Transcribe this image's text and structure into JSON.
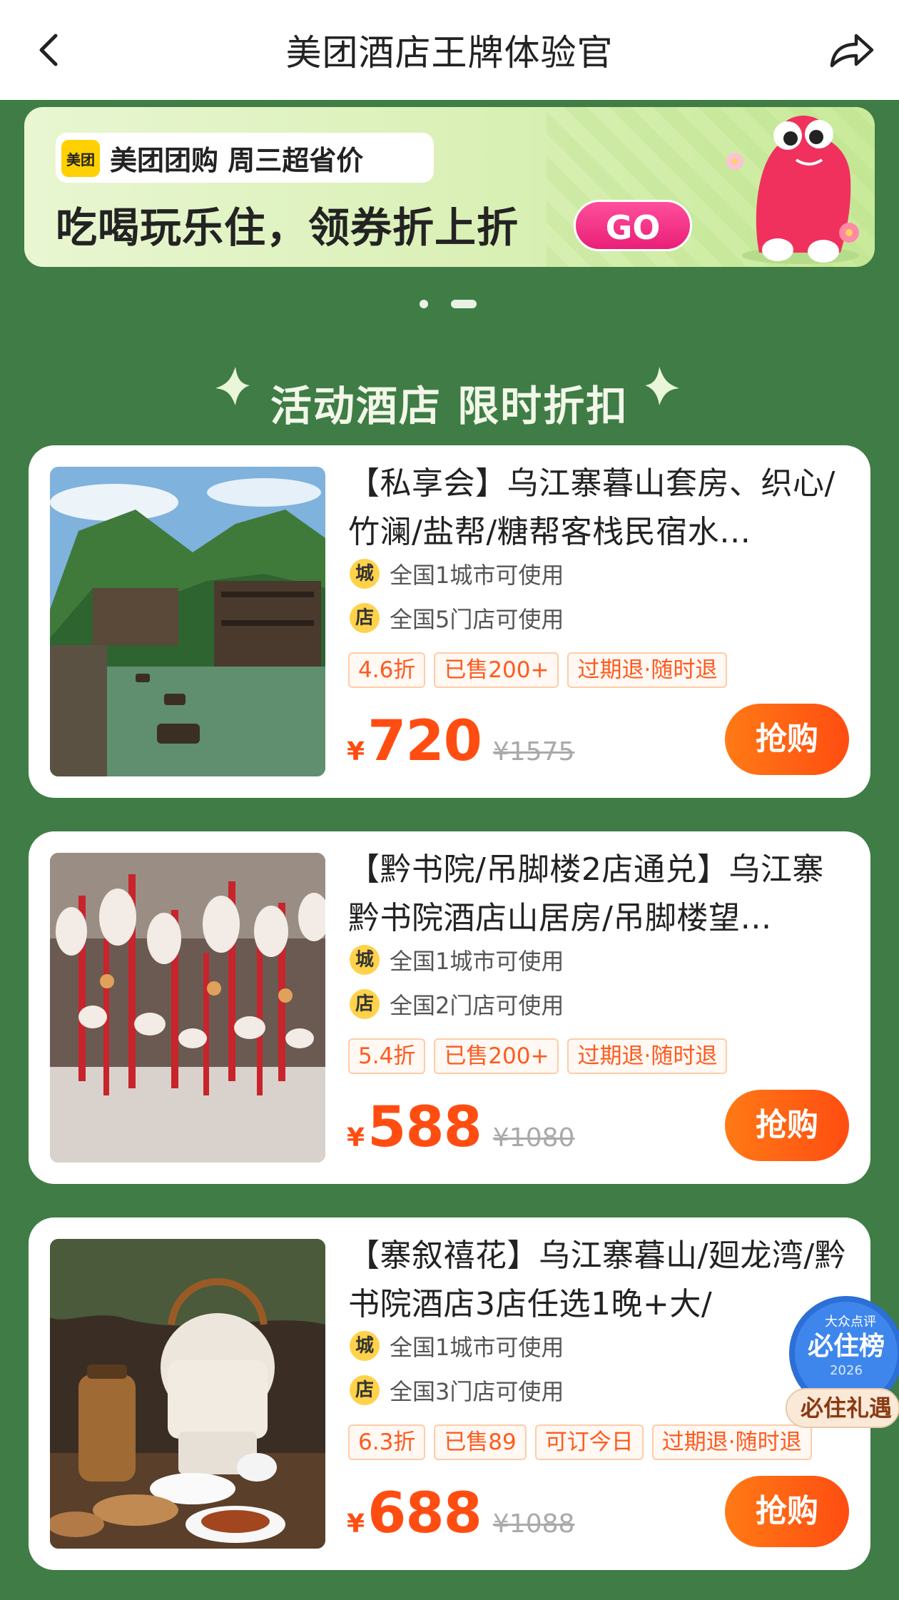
{
  "header": {
    "title": "美团酒店王牌体验官",
    "back_icon": "chevron-left-icon",
    "share_icon": "share-icon"
  },
  "banner": {
    "logo_text": "美团",
    "brand_text": "美团团购 周三超省价",
    "headline": "吃喝玩乐住，领券折上折",
    "go_label": "GO"
  },
  "carousel": {
    "active_index": 1,
    "count": 2
  },
  "section": {
    "title": "活动酒店 限时折扣"
  },
  "products": [
    {
      "name": "【私享会】乌江寨暮山套房、织心/竹澜/盐帮/糖帮客栈民宿水…",
      "city_icon": "城",
      "city_text": "全国1城市可使用",
      "store_icon": "店",
      "store_text": "全国5门店可使用",
      "tags": [
        "4.6折",
        "已售200+",
        "过期退·随时退"
      ],
      "currency": "¥",
      "price": "720",
      "original_price": "¥1575",
      "buy_label": "抢购"
    },
    {
      "name": "【黔书院/吊脚楼2店通兑】乌江寨黔书院酒店山居房/吊脚楼望…",
      "city_icon": "城",
      "city_text": "全国1城市可使用",
      "store_icon": "店",
      "store_text": "全国2门店可使用",
      "tags": [
        "5.4折",
        "已售200+",
        "过期退·随时退"
      ],
      "currency": "¥",
      "price": "588",
      "original_price": "¥1080",
      "buy_label": "抢购"
    },
    {
      "name": "【寨叙禧花】乌江寨暮山/廻龙湾/黔书院酒店3店任选1晚+大/",
      "city_icon": "城",
      "city_text": "全国1城市可使用",
      "store_icon": "店",
      "store_text": "全国3门店可使用",
      "tags": [
        "6.3折",
        "已售89",
        "可订今日",
        "过期退·随时退"
      ],
      "currency": "¥",
      "price": "688",
      "original_price": "¥1088",
      "buy_label": "抢购"
    }
  ],
  "float_badge": {
    "brand": "大众点评",
    "title": "必住榜",
    "year": "2026",
    "caption": "必住礼遇"
  },
  "colors": {
    "page_bg": "#3f7c46",
    "accent": "#ff4d12",
    "tag_border": "#ffcca8",
    "banner_pink": "#e91f78"
  }
}
